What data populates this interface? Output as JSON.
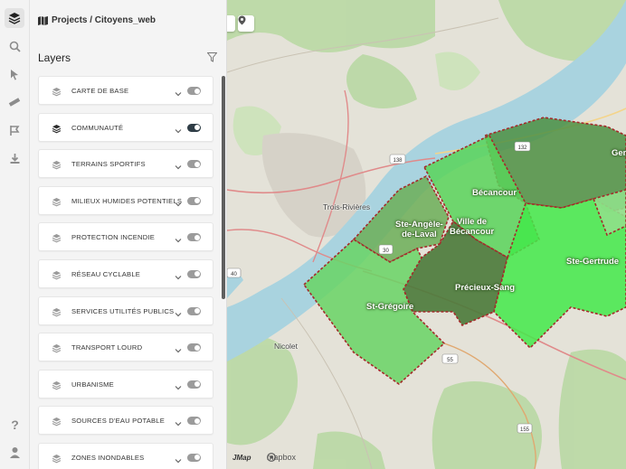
{
  "breadcrumb": "Projects / Citoyens_web",
  "panel": {
    "title": "Layers"
  },
  "layers": [
    {
      "label": "CARTE DE BASE",
      "on": false
    },
    {
      "label": "COMMUNAUTÉ",
      "on": true
    },
    {
      "label": "TERRAINS SPORTIFS",
      "on": false
    },
    {
      "label": "MILIEUX HUMIDES POTENTIELS",
      "on": false
    },
    {
      "label": "PROTECTION INCENDIE",
      "on": false
    },
    {
      "label": "RÉSEAU CYCLABLE",
      "on": false
    },
    {
      "label": "SERVICES UTILITÉS PUBLICS",
      "on": false
    },
    {
      "label": "TRANSPORT LOURD",
      "on": false
    },
    {
      "label": "URBANISME",
      "on": false
    },
    {
      "label": "SOURCES D'EAU POTABLE",
      "on": false
    },
    {
      "label": "ZONES INONDABLES",
      "on": false
    }
  ],
  "map": {
    "regions": {
      "becancour": "Bécancour",
      "ste_angele": "Ste-Angèle-\nde-Laval",
      "ville_becancour": "Ville de\nBécancour",
      "precieux_sang": "Précieux-Sang",
      "st_gregoire": "St-Grégoire",
      "ste_gertrude": "Ste-Gertrude",
      "gen": "Gen"
    },
    "places": {
      "trois_rivieres": "Trois-Rivières",
      "nicolet": "Nicolet"
    },
    "roads": [
      "138",
      "132",
      "155",
      "55",
      "40",
      "30"
    ],
    "attribution": {
      "jmap": "JMap",
      "mapbox": "mapbox"
    }
  },
  "colors": {
    "accent": "#2f3d46",
    "region_light": "#5cd65c",
    "region_dark": "#4a7a3a",
    "river": "#a9d3df"
  }
}
